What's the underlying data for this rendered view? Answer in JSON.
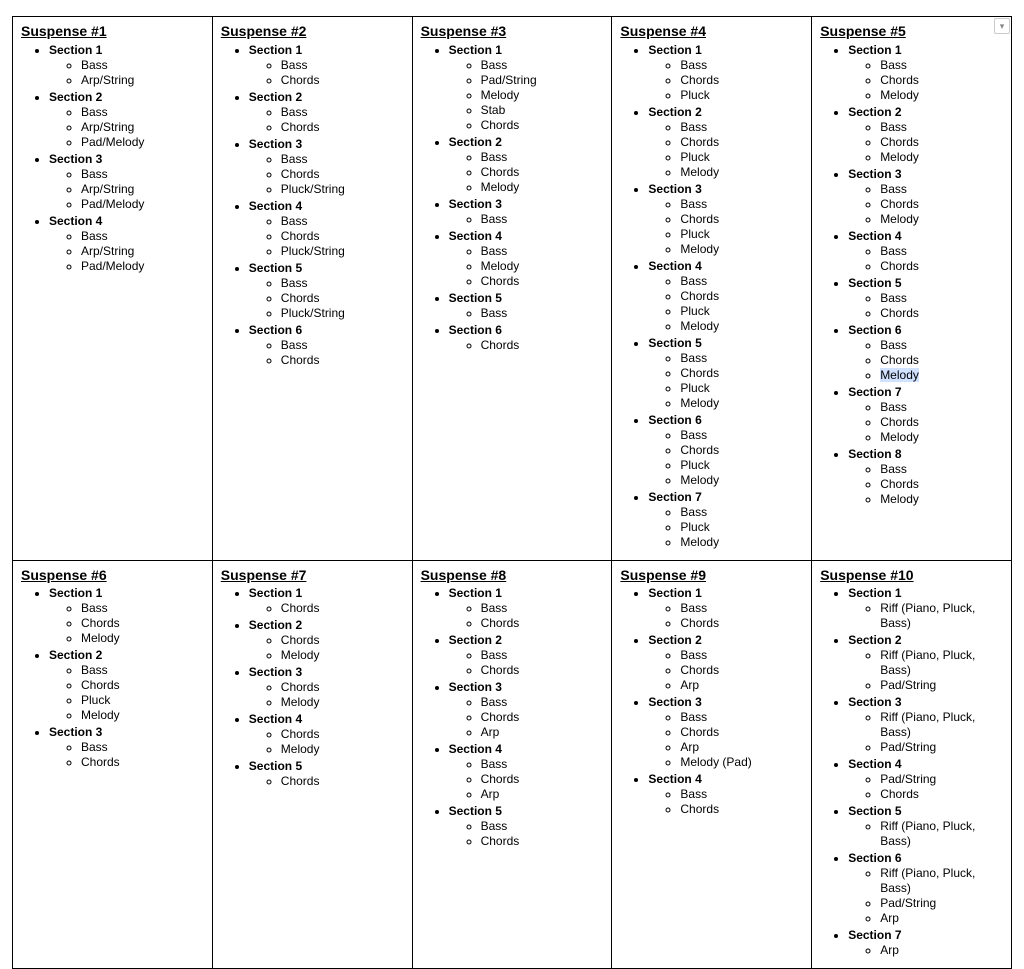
{
  "tracks": [
    {
      "title": "Suspense #1",
      "sections": [
        {
          "label": "Section 1",
          "items": [
            "Bass",
            "Arp/String"
          ]
        },
        {
          "label": "Section 2",
          "items": [
            "Bass",
            "Arp/String",
            "Pad/Melody"
          ]
        },
        {
          "label": "Section 3",
          "items": [
            "Bass",
            "Arp/String",
            "Pad/Melody"
          ]
        },
        {
          "label": "Section 4",
          "items": [
            "Bass",
            "Arp/String",
            "Pad/Melody"
          ]
        }
      ]
    },
    {
      "title": "Suspense #2",
      "sections": [
        {
          "label": "Section 1",
          "items": [
            "Bass",
            "Chords"
          ]
        },
        {
          "label": "Section 2",
          "items": [
            "Bass",
            "Chords"
          ]
        },
        {
          "label": "Section 3",
          "items": [
            "Bass",
            "Chords",
            "Pluck/String"
          ]
        },
        {
          "label": "Section 4",
          "items": [
            "Bass",
            "Chords",
            "Pluck/String"
          ]
        },
        {
          "label": "Section 5",
          "items": [
            "Bass",
            "Chords",
            "Pluck/String"
          ]
        },
        {
          "label": "Section 6",
          "items": [
            "Bass",
            "Chords"
          ]
        }
      ]
    },
    {
      "title": "Suspense #3",
      "sections": [
        {
          "label": "Section 1",
          "items": [
            "Bass",
            "Pad/String",
            "Melody",
            "Stab",
            "Chords"
          ]
        },
        {
          "label": "Section 2",
          "items": [
            "Bass",
            "Chords",
            "Melody"
          ]
        },
        {
          "label": "Section 3",
          "items": [
            "Bass"
          ]
        },
        {
          "label": "Section 4",
          "items": [
            "Bass",
            "Melody",
            "Chords"
          ]
        },
        {
          "label": "Section 5",
          "items": [
            "Bass"
          ]
        },
        {
          "label": "Section 6",
          "items": [
            "Chords"
          ]
        }
      ]
    },
    {
      "title": "Suspense #4",
      "sections": [
        {
          "label": "Section 1",
          "items": [
            "Bass",
            "Chords",
            "Pluck"
          ]
        },
        {
          "label": "Section 2",
          "items": [
            "Bass",
            "Chords",
            "Pluck",
            "Melody"
          ]
        },
        {
          "label": "Section 3",
          "items": [
            "Bass",
            "Chords",
            "Pluck",
            "Melody"
          ]
        },
        {
          "label": "Section 4",
          "items": [
            "Bass",
            "Chords",
            "Pluck",
            "Melody"
          ]
        },
        {
          "label": "Section 5",
          "items": [
            "Bass",
            "Chords",
            "Pluck",
            "Melody"
          ]
        },
        {
          "label": "Section 6",
          "items": [
            "Bass",
            "Chords",
            "Pluck",
            "Melody"
          ]
        },
        {
          "label": "Section 7",
          "items": [
            "Bass",
            "Pluck",
            "Melody"
          ]
        }
      ]
    },
    {
      "title": "Suspense #5",
      "sections": [
        {
          "label": "Section 1",
          "items": [
            "Bass",
            "Chords",
            "Melody"
          ]
        },
        {
          "label": "Section 2",
          "items": [
            "Bass",
            "Chords",
            "Melody"
          ]
        },
        {
          "label": "Section 3",
          "items": [
            "Bass",
            "Chords",
            "Melody"
          ]
        },
        {
          "label": "Section 4",
          "items": [
            "Bass",
            "Chords"
          ]
        },
        {
          "label": "Section 5",
          "items": [
            "Bass",
            "Chords"
          ]
        },
        {
          "label": "Section 6",
          "items": [
            "Bass",
            "Chords",
            "Melody"
          ],
          "selected_item_index": 2
        },
        {
          "label": "Section 7",
          "items": [
            "Bass",
            "Chords",
            "Melody"
          ]
        },
        {
          "label": "Section 8",
          "items": [
            "Bass",
            "Chords",
            "Melody"
          ]
        }
      ]
    },
    {
      "title": "Suspense #6",
      "sections": [
        {
          "label": "Section 1",
          "items": [
            "Bass",
            "Chords",
            "Melody"
          ]
        },
        {
          "label": "Section 2",
          "items": [
            "Bass",
            "Chords",
            "Pluck",
            "Melody"
          ]
        },
        {
          "label": "Section 3",
          "items": [
            "Bass",
            "Chords"
          ]
        }
      ]
    },
    {
      "title": "Suspense #7",
      "sections": [
        {
          "label": "Section 1",
          "items": [
            "Chords"
          ]
        },
        {
          "label": "Section 2",
          "items": [
            "Chords",
            "Melody"
          ]
        },
        {
          "label": "Section 3",
          "items": [
            "Chords",
            "Melody"
          ]
        },
        {
          "label": "Section 4",
          "items": [
            "Chords",
            "Melody"
          ]
        },
        {
          "label": "Section 5",
          "items": [
            "Chords"
          ]
        }
      ]
    },
    {
      "title": "Suspense #8",
      "sections": [
        {
          "label": "Section 1",
          "items": [
            "Bass",
            "Chords"
          ]
        },
        {
          "label": "Section 2",
          "items": [
            "Bass",
            "Chords"
          ]
        },
        {
          "label": "Section 3",
          "items": [
            "Bass",
            "Chords",
            "Arp"
          ]
        },
        {
          "label": "Section 4",
          "items": [
            "Bass",
            "Chords",
            "Arp"
          ]
        },
        {
          "label": "Section 5",
          "items": [
            "Bass",
            "Chords"
          ]
        }
      ]
    },
    {
      "title": "Suspense #9",
      "sections": [
        {
          "label": "Section 1",
          "items": [
            "Bass",
            "Chords"
          ]
        },
        {
          "label": "Section 2",
          "items": [
            "Bass",
            "Chords",
            "Arp"
          ]
        },
        {
          "label": "Section 3",
          "items": [
            "Bass",
            "Chords",
            "Arp",
            "Melody (Pad)"
          ]
        },
        {
          "label": "Section 4",
          "items": [
            "Bass",
            "Chords"
          ]
        }
      ]
    },
    {
      "title": "Suspense #10",
      "sections": [
        {
          "label": "Section 1",
          "items": [
            "Riff (Piano, Pluck, Bass)"
          ]
        },
        {
          "label": "Section 2",
          "items": [
            "Riff (Piano, Pluck, Bass)",
            "Pad/String"
          ]
        },
        {
          "label": "Section 3",
          "items": [
            "Riff (Piano, Pluck, Bass)",
            "Pad/String"
          ]
        },
        {
          "label": "Section 4",
          "items": [
            "Pad/String",
            "Chords"
          ]
        },
        {
          "label": "Section 5",
          "items": [
            "Riff (Piano, Pluck, Bass)"
          ]
        },
        {
          "label": "Section 6",
          "items": [
            "Riff (Piano, Pluck, Bass)",
            "Pad/String",
            "Arp"
          ]
        },
        {
          "label": "Section 7",
          "items": [
            "Arp"
          ]
        }
      ]
    }
  ]
}
